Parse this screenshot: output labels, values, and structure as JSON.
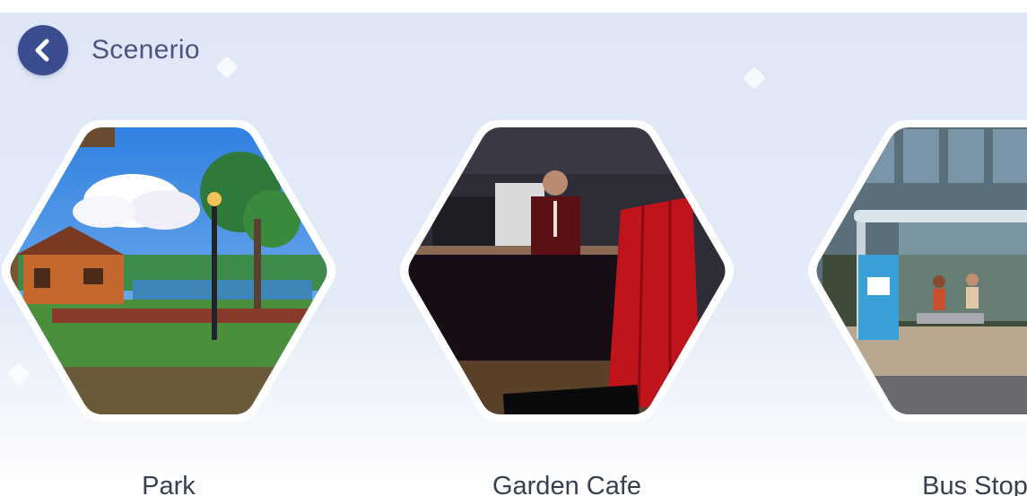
{
  "header": {
    "back_icon": "chevron-left-icon",
    "title": "Scenerio"
  },
  "scenes": [
    {
      "label": "Park"
    },
    {
      "label": "Garden Cafe"
    },
    {
      "label": "Bus Stop"
    }
  ],
  "colors": {
    "back_button": "#3c4d8f",
    "title_text": "#4a5580",
    "label_text": "#3a3f4e",
    "background": "#e2e9f7",
    "card_border": "#ffffff"
  }
}
